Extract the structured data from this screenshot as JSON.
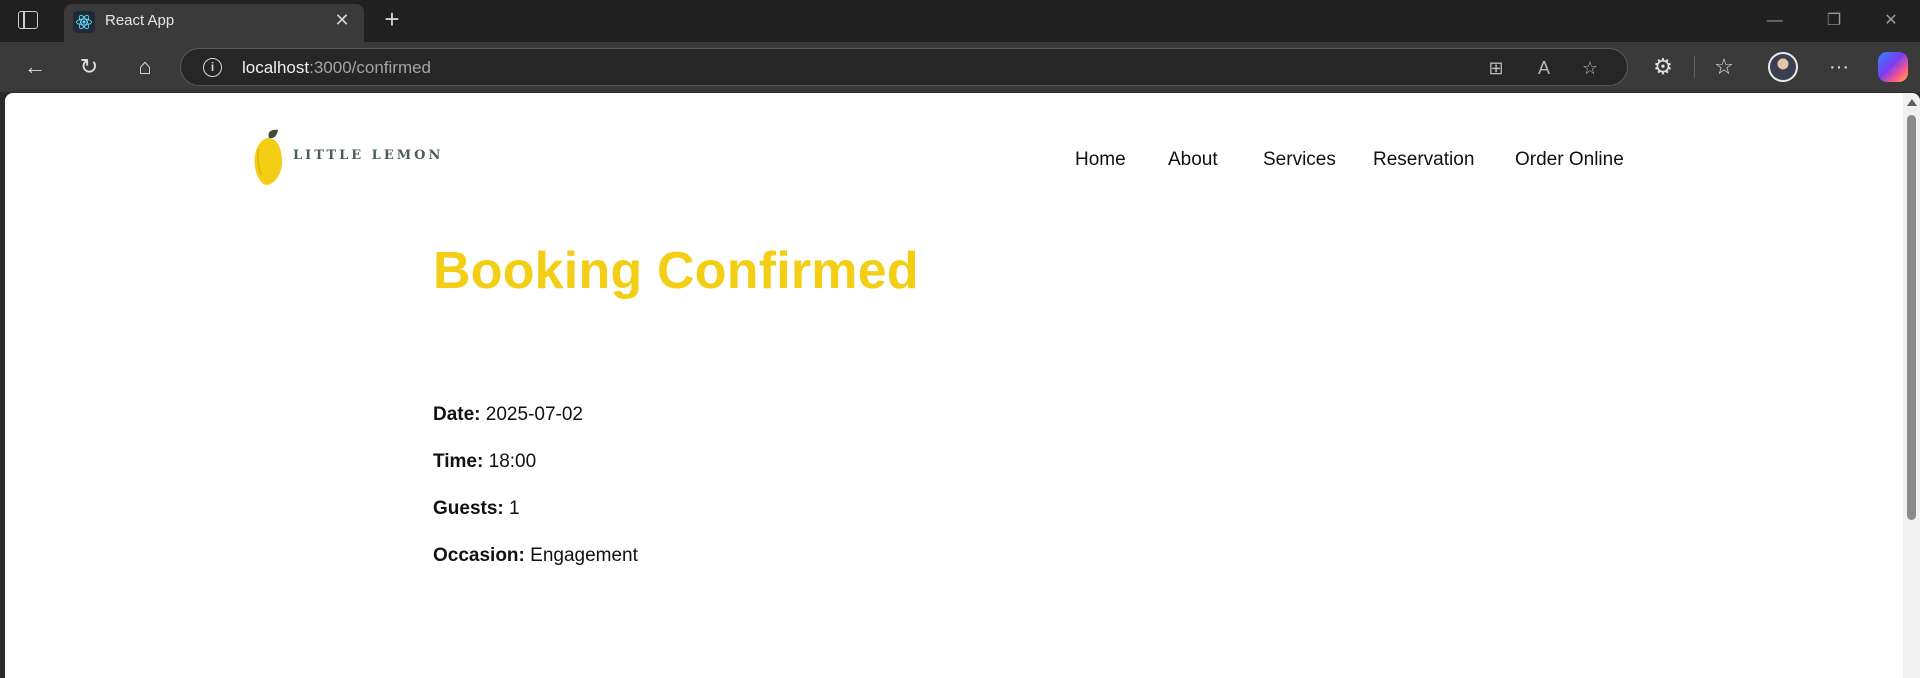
{
  "browser": {
    "tab_title": "React App",
    "url_host": "localhost",
    "url_rest": ":3000/confirmed",
    "icons": {
      "sidebar": "sidebar-toggle-icon",
      "favicon": "react-icon",
      "close": "close-icon",
      "new_tab": "plus-icon",
      "back": "back-arrow-icon",
      "reload": "reload-icon",
      "home": "home-icon",
      "info": "info-icon",
      "split": "split-screen-icon",
      "read_aloud": "read-aloud-icon",
      "favorite": "star-icon",
      "extensions": "puzzle-icon",
      "favorites": "favorites-icon",
      "more": "more-icon",
      "copilot": "copilot-icon"
    }
  },
  "site": {
    "logo_text": "LITTLE LEMON",
    "nav": [
      "Home",
      "About",
      "Services",
      "Reservation",
      "Order Online"
    ]
  },
  "booking": {
    "heading": "Booking Confirmed",
    "date_label": "Date:",
    "date_value": "2025-07-02",
    "time_label": "Time:",
    "time_value": "18:00",
    "guests_label": "Guests:",
    "guests_value": "1",
    "occasion_label": "Occasion:",
    "occasion_value": "Engagement"
  },
  "colors": {
    "accent_yellow": "#F4CE14",
    "brand_green": "#495E57"
  }
}
